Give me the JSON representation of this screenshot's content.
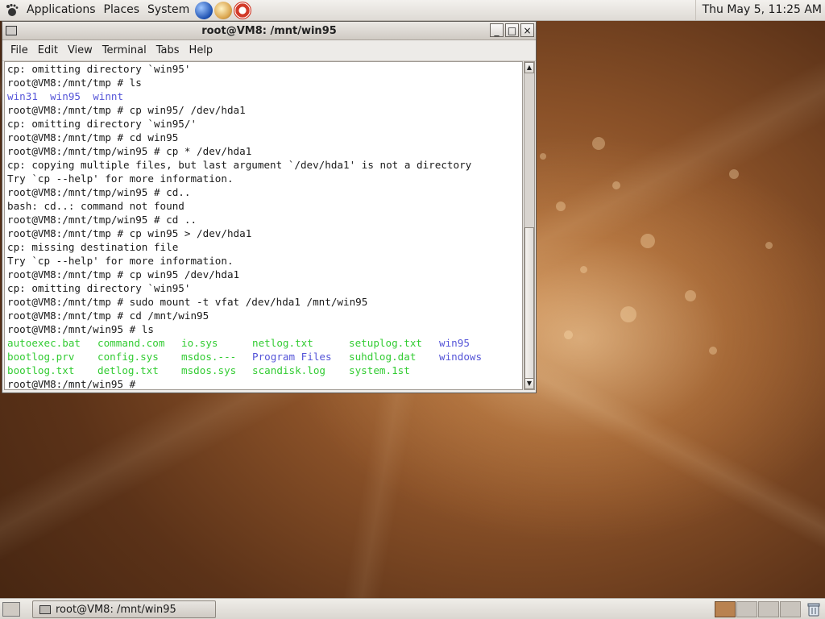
{
  "top_panel": {
    "menus": [
      "Applications",
      "Places",
      "System"
    ],
    "clock": "Thu May  5, 11:25 AM"
  },
  "window": {
    "title": "root@VM8: /mnt/win95",
    "buttons": {
      "minimize": "_",
      "maximize": "□",
      "close": "×"
    },
    "menubar": [
      "File",
      "Edit",
      "View",
      "Terminal",
      "Tabs",
      "Help"
    ]
  },
  "terminal": {
    "lines": [
      "cp: omitting directory `win95'",
      "root@VM8:/mnt/tmp # ls",
      "",
      "root@VM8:/mnt/tmp # cp win95/ /dev/hda1",
      "cp: omitting directory `win95/'",
      "root@VM8:/mnt/tmp # cd win95",
      "root@VM8:/mnt/tmp/win95 # cp * /dev/hda1",
      "cp: copying multiple files, but last argument `/dev/hda1' is not a directory",
      "Try `cp --help' for more information.",
      "root@VM8:/mnt/tmp/win95 # cd..",
      "bash: cd..: command not found",
      "root@VM8:/mnt/tmp/win95 # cd ..",
      "root@VM8:/mnt/tmp # cp win95 > /dev/hda1",
      "cp: missing destination file",
      "Try `cp --help' for more information.",
      "root@VM8:/mnt/tmp # cp win95 /dev/hda1",
      "cp: omitting directory `win95'",
      "root@VM8:/mnt/tmp # sudo mount -t vfat /dev/hda1 /mnt/win95",
      "root@VM8:/mnt/tmp # cd /mnt/win95",
      "root@VM8:/mnt/win95 # ls"
    ],
    "ls_tmp": [
      "win31",
      "win95",
      "winnt"
    ],
    "ls_win95": [
      [
        "autoexec.bat",
        "command.com",
        "io.sys",
        "netlog.txt",
        "setuplog.txt",
        "win95"
      ],
      [
        "bootlog.prv",
        "config.sys",
        "msdos.---",
        "Program Files",
        "suhdlog.dat",
        "windows"
      ],
      [
        "bootlog.txt",
        "detlog.txt",
        "msdos.sys",
        "scandisk.log",
        "system.1st",
        ""
      ]
    ],
    "prompt": "root@VM8:/mnt/win95 # "
  },
  "bottom_panel": {
    "task": "root@VM8: /mnt/win95"
  },
  "colors": {
    "dir": "#5555d8",
    "file_exec": "#33cc33"
  }
}
